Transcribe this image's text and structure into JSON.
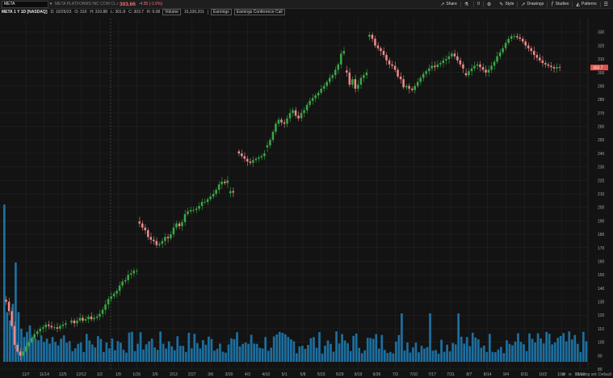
{
  "toolbar": {
    "symbol": "META",
    "company": "META PLATFORMS INC COM CL A",
    "last_price": "303.66",
    "change": "-4.95 (-1.6%)",
    "share_label": "Share",
    "style_label": "Style",
    "drawings_label": "Drawings",
    "studies_label": "Studies",
    "patterns_label": "Patterns",
    "counter": "0"
  },
  "info": {
    "title": "META 1 Y 1D [NASDAQ]",
    "date": "D: 10/25/23",
    "open": "O: 310",
    "high": "H: 310.88",
    "low": "L: 301.8",
    "close": "C: 303.7",
    "range": "R: 9.08",
    "volume_label": "Volume",
    "volume_value": "15,330,201",
    "pill1": "Earnings",
    "pill2": "Earnings Conference Call"
  },
  "footer": {
    "drawing_set": "Drawing set: Default"
  },
  "colors": {
    "up": "#3aa845",
    "down": "#f08a8a",
    "volume": "#1d6fa0",
    "price_tag": "#e0524a"
  },
  "chart_data": {
    "type": "candlestick",
    "ylim": [
      80,
      340
    ],
    "y_ticks": [
      80,
      90,
      100,
      110,
      120,
      130,
      140,
      150,
      160,
      170,
      180,
      190,
      200,
      210,
      220,
      230,
      240,
      250,
      260,
      270,
      280,
      290,
      300,
      310,
      320,
      330
    ],
    "x_ticks": [
      "11/7",
      "11/14",
      "12/5",
      "12/12",
      "1/2",
      "1/9",
      "1/16",
      "2/6",
      "2/13",
      "2/27",
      "3/6",
      "3/20",
      "4/3",
      "4/10",
      "5/1",
      "5/8",
      "5/15",
      "5/29",
      "6/19",
      "6/26",
      "7/3",
      "7/10",
      "7/17",
      "7/31",
      "8/7",
      "8/14",
      "9/4",
      "9/11",
      "10/2",
      "10/9",
      "10/16"
    ],
    "last_price_tag": "303.7",
    "segments": [
      {
        "start_date": "10/26",
        "days": 22,
        "close": [
          130,
          123,
          112,
          98,
          93,
          90,
          93,
          97,
          100,
          103,
          106,
          108,
          110,
          111,
          113,
          112,
          111,
          111,
          110,
          112,
          113,
          114
        ]
      },
      {
        "days": 24,
        "close": [
          116,
          114,
          116,
          118,
          116,
          117,
          119,
          117,
          118,
          119,
          121,
          124,
          128,
          132,
          134,
          136,
          138,
          142,
          145,
          146,
          150,
          151,
          153,
          153
        ]
      },
      {
        "days": 32,
        "close": [
          188,
          185,
          183,
          178,
          176,
          175,
          172,
          173,
          175,
          178,
          177,
          180,
          185,
          188,
          186,
          189,
          195,
          197,
          198,
          198,
          199,
          201,
          204,
          204,
          206,
          208,
          210,
          213,
          217,
          219,
          218,
          220
        ]
      },
      {
        "days": 2,
        "close": [
          212,
          211
        ]
      },
      {
        "days": 10,
        "close": [
          240,
          238,
          236,
          234,
          233,
          235,
          236,
          237,
          238,
          240
        ]
      },
      {
        "days": 28,
        "close": [
          246,
          250,
          256,
          262,
          265,
          263,
          262,
          266,
          270,
          272,
          268,
          266,
          270,
          272,
          276,
          279,
          281,
          283,
          285,
          288,
          290,
          293,
          296,
          298,
          302,
          306,
          314,
          316
        ]
      },
      {
        "days": 8,
        "close": [
          300,
          291,
          295,
          288,
          291,
          296,
          298,
          300
        ]
      },
      {
        "days": 34,
        "close": [
          328,
          325,
          320,
          318,
          316,
          313,
          309,
          306,
          305,
          302,
          297,
          295,
          289,
          290,
          288,
          287,
          290,
          293,
          296,
          299,
          301,
          303,
          305,
          304,
          306,
          307,
          309,
          310,
          312,
          314,
          312,
          309,
          306,
          303
        ]
      },
      {
        "days": 34,
        "close": [
          298,
          301,
          303,
          305,
          306,
          304,
          302,
          300,
          302,
          305,
          308,
          312,
          315,
          318,
          322,
          325,
          327,
          327,
          326,
          325,
          323,
          320,
          318,
          316,
          313,
          311,
          309,
          307,
          306,
          305,
          304,
          303,
          304,
          303.7
        ]
      }
    ],
    "volume": {
      "ylim_pct": 100,
      "values": [
        0.95,
        0.3,
        0.25,
        0.35,
        0.6,
        0.3,
        0.2,
        0.15,
        0.18,
        0.22,
        0.15,
        0.14,
        0.13,
        0.16,
        0.12,
        0.14,
        0.11,
        0.15,
        0.12,
        0.1,
        0.14,
        0.16
      ]
    }
  }
}
